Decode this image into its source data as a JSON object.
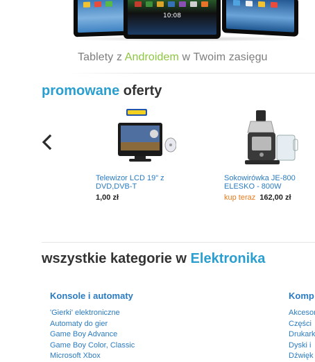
{
  "banner": {
    "clock": "10:08",
    "tagline_before": "Tablety z ",
    "tagline_highlight": "Androidem",
    "tagline_after": " w Twoim zasięgu",
    "colors": {
      "highlight": "#8dc63f",
      "text": "#7d7d7d"
    }
  },
  "promo": {
    "title_accent": "promowane",
    "title_rest": " oferty",
    "prev_icon": "chevron-left-icon",
    "products": [
      {
        "name": "Telewizor LCD 19\" z DVD,DVB-T",
        "buy_now": "",
        "price": "1,00 zł"
      },
      {
        "name": "Sokowirówka JE-800 ELESKO - 800W",
        "buy_now": "kup teraz",
        "price": "162,00 zł"
      }
    ]
  },
  "categories": {
    "title_before": "wszystkie kategorie w ",
    "title_accent": "Elektronika",
    "columns": [
      {
        "heading": "Konsole i automaty",
        "items": [
          "'Gierki' elektroniczne",
          "Automaty do gier",
          "Game Boy Advance",
          "Game Boy Color, Classic",
          "Microsoft Xbox"
        ]
      },
      {
        "heading": "Komp",
        "items": [
          "Akcesoria",
          "Części",
          "Drukarki",
          "Dyski i",
          "Dźwięk"
        ]
      }
    ]
  },
  "colors": {
    "accent": "#2a9fcf",
    "link": "#2a7bc0",
    "buy_now": "#e87a1c"
  }
}
